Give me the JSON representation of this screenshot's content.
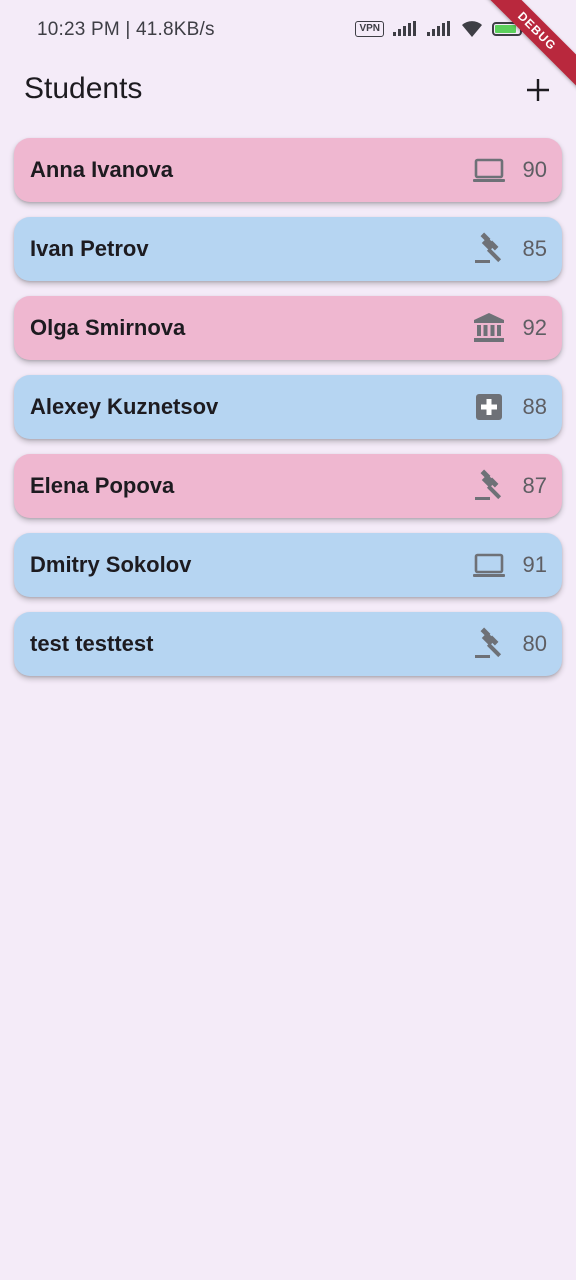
{
  "status_bar": {
    "time_speed": "10:23 PM | 41.8KB/s",
    "vpn_label": "VPN",
    "battery_level": 0.9,
    "battery_label": "100"
  },
  "debug_banner": "DEBUG",
  "app_bar": {
    "title": "Students",
    "add_icon": "plus-icon"
  },
  "colors": {
    "pink": "#efb7d0",
    "blue": "#b6d5f2",
    "icon_gray": "#6e7177"
  },
  "students": [
    {
      "name": "Anna Ivanova",
      "icon": "laptop-icon",
      "score": "90",
      "color": "pink"
    },
    {
      "name": "Ivan Petrov",
      "icon": "gavel-icon",
      "score": "85",
      "color": "blue"
    },
    {
      "name": "Olga Smirnova",
      "icon": "bank-icon",
      "score": "92",
      "color": "pink"
    },
    {
      "name": "Alexey Kuznetsov",
      "icon": "medical-icon",
      "score": "88",
      "color": "blue"
    },
    {
      "name": "Elena Popova",
      "icon": "gavel-icon",
      "score": "87",
      "color": "pink"
    },
    {
      "name": "Dmitry Sokolov",
      "icon": "laptop-icon",
      "score": "91",
      "color": "blue"
    },
    {
      "name": "test testtest",
      "icon": "gavel-icon",
      "score": "80",
      "color": "blue"
    }
  ]
}
